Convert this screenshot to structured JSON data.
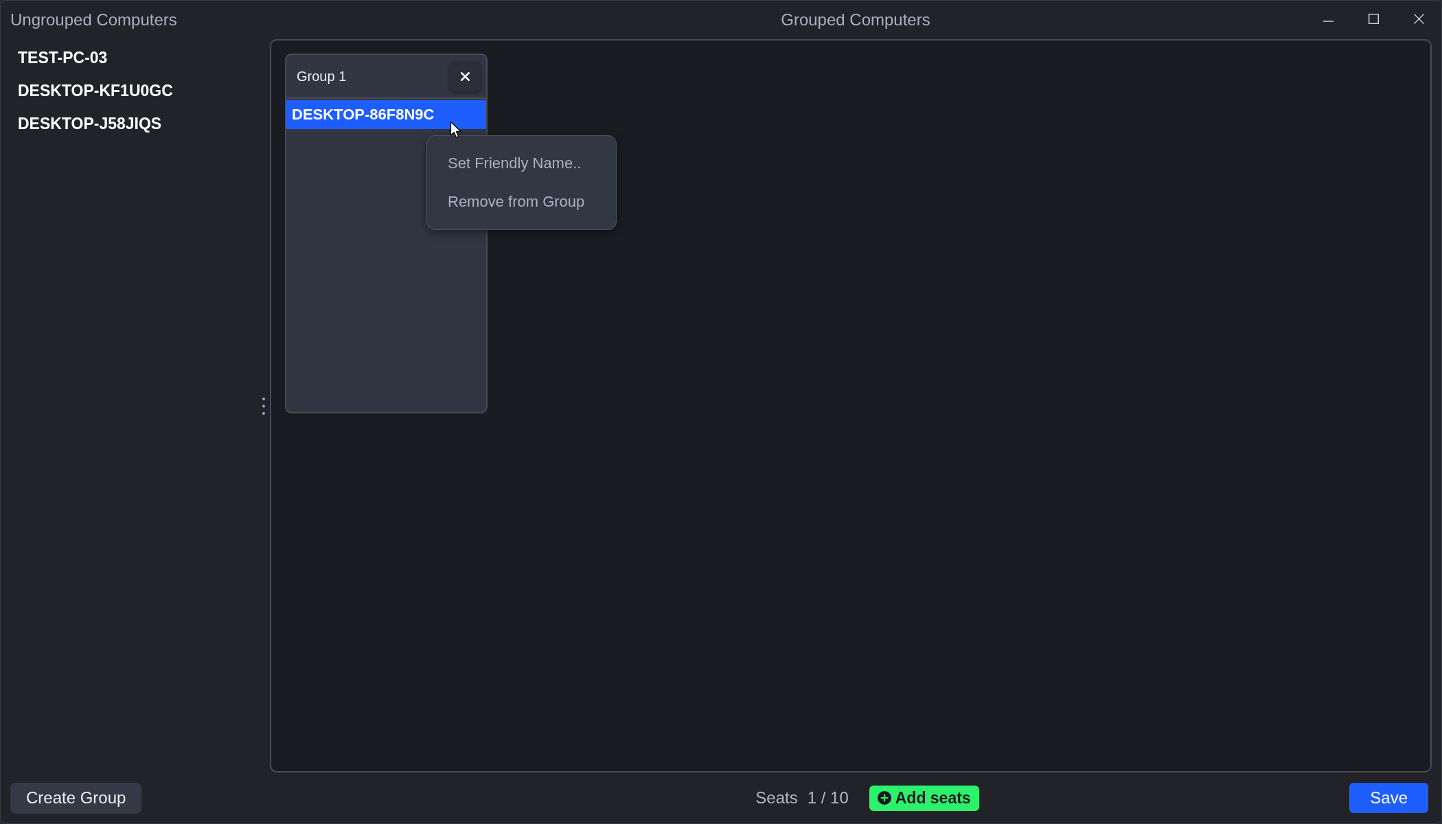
{
  "ungrouped": {
    "title": "Ungrouped Computers",
    "items": [
      {
        "label": "TEST-PC-03",
        "selected": false
      },
      {
        "label": "DESKTOP-KF1U0GC",
        "selected": false
      },
      {
        "label": "DESKTOP-J58JIQS",
        "selected": false
      }
    ]
  },
  "grouped": {
    "title": "Grouped Computers",
    "groups": [
      {
        "name": "Group 1",
        "members": [
          {
            "label": "DESKTOP-86F8N9C",
            "selected": true
          }
        ]
      }
    ],
    "context_menu": {
      "items": [
        {
          "label": "Set Friendly Name.."
        },
        {
          "label": "Remove from Group"
        }
      ]
    }
  },
  "footer": {
    "create_group_button": "Create Group",
    "seats_label": "Seats",
    "seats_value": "1 / 10",
    "add_seats_button": "Add seats",
    "save_button": "Save"
  }
}
